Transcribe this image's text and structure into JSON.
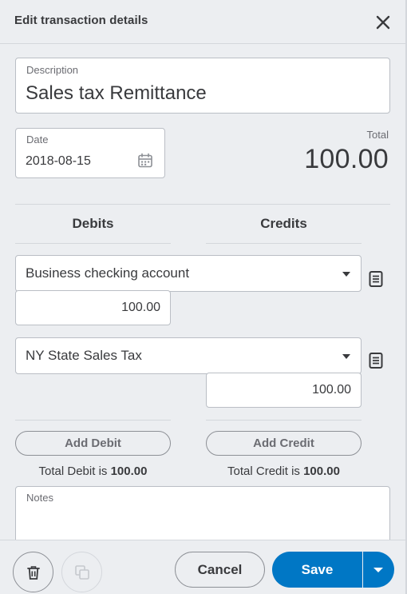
{
  "header": {
    "title": "Edit transaction details",
    "close_icon": "close-icon"
  },
  "form": {
    "description": {
      "label": "Description",
      "value": "Sales tax Remittance"
    },
    "date": {
      "label": "Date",
      "value": "2018-08-15",
      "icon": "calendar-icon"
    },
    "total": {
      "label": "Total",
      "value": "100.00"
    }
  },
  "columns": {
    "debits": "Debits",
    "credits": "Credits"
  },
  "lines": [
    {
      "account": "Business checking account",
      "amount": "100.00",
      "side": "debit",
      "icon": "memo-icon"
    },
    {
      "account": "NY State Sales Tax",
      "amount": "100.00",
      "side": "credit",
      "icon": "memo-icon"
    }
  ],
  "actions": {
    "add_debit": "Add Debit",
    "add_credit": "Add Credit"
  },
  "totals": {
    "debit_prefix": "Total Debit is",
    "debit_value": "100.00",
    "credit_prefix": "Total Credit is",
    "credit_value": "100.00"
  },
  "notes": {
    "label": "Notes",
    "value": ""
  },
  "footer": {
    "delete_icon": "trash-icon",
    "copy_icon": "copy-icon",
    "cancel_label": "Cancel",
    "save_label": "Save",
    "save_menu_icon": "chevron-down-icon"
  },
  "colors": {
    "accent": "#0077c5",
    "panel_bg": "#eceef1",
    "text": "#393a3d",
    "muted": "#6b6c72",
    "border": "#babec5"
  }
}
